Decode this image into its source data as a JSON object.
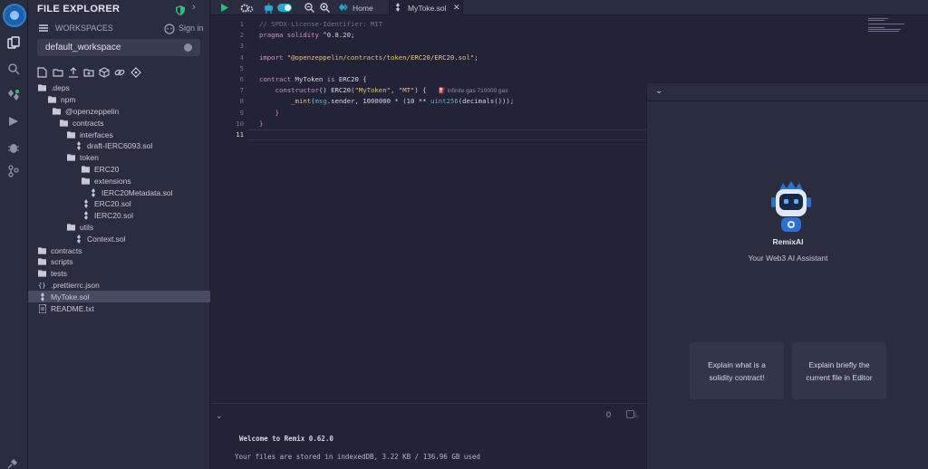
{
  "explorer": {
    "title": "FILE EXPLORER",
    "workspaces_label": "WORKSPACES",
    "signin_label": "Sign in",
    "workspace_value": "default_workspace",
    "tree": [
      {
        "label": ".deps",
        "type": "folder",
        "depth": 0
      },
      {
        "label": "npm",
        "type": "folder",
        "depth": 1
      },
      {
        "label": "@openzeppelin",
        "type": "folder",
        "depth": 2
      },
      {
        "label": "contracts",
        "type": "folder",
        "depth": 3
      },
      {
        "label": "interfaces",
        "type": "folder",
        "depth": 4
      },
      {
        "label": "draft-IERC6093.sol",
        "type": "sol",
        "depth": 5
      },
      {
        "label": "token",
        "type": "folder",
        "depth": 4
      },
      {
        "label": "ERC20",
        "type": "folder",
        "depth": 5
      },
      {
        "label": "extensions",
        "type": "folder",
        "depth": 6
      },
      {
        "label": "IERC20Metadata.sol",
        "type": "sol",
        "depth": 7
      },
      {
        "label": "ERC20.sol",
        "type": "sol",
        "depth": 6
      },
      {
        "label": "IERC20.sol",
        "type": "sol",
        "depth": 6
      },
      {
        "label": "utils",
        "type": "folder",
        "depth": 4
      },
      {
        "label": "Context.sol",
        "type": "sol",
        "depth": 5
      },
      {
        "label": "contracts",
        "type": "folder",
        "depth": 0
      },
      {
        "label": "scripts",
        "type": "folder",
        "depth": 0
      },
      {
        "label": "tests",
        "type": "folder",
        "depth": 0
      },
      {
        "label": ".prettierrc.json",
        "type": "json",
        "depth": 0
      },
      {
        "label": "MyToke.sol",
        "type": "sol",
        "depth": 0,
        "selected": true
      },
      {
        "label": "README.txt",
        "type": "txt",
        "depth": 0
      }
    ]
  },
  "tabs": {
    "home_label": "Home",
    "file_label": "MyToke.sol"
  },
  "editor": {
    "line_numbers": [
      "1",
      "2",
      "3",
      "4",
      "5",
      "6",
      "7",
      "8",
      "9",
      "10",
      "11"
    ],
    "current_line": "11",
    "gas_hint": "infinite gas 710000 gas",
    "code": {
      "l1": "// SPDX-License-Identifier: MIT",
      "l2_kw": "pragma solidity",
      "l2_val": " ^0.8.20;",
      "l4_kw": "import",
      "l4_str": "\"@openzeppelin/contracts/token/ERC20/ERC20.sol\"",
      "l4_end": ";",
      "l6_kw": "contract",
      "l6_name": " MyToken ",
      "l6_is": "is",
      "l6_rest": " ERC20 {",
      "l7_kw": "constructor",
      "l7_a": "() ERC20(",
      "l7_s1": "\"MyToken\"",
      "l7_b": ", ",
      "l7_s2": "\"MT\"",
      "l7_c": ") {",
      "l8_fn": "_mint",
      "l8_a": "(",
      "l8_msg": "msg",
      "l8_b": ".sender, 1000000 * (10 ** ",
      "l8_ty": "uint256",
      "l8_c": "(decimals()));",
      "l9": "}",
      "l10": "}"
    }
  },
  "terminal": {
    "count": "0",
    "clear_label": "L",
    "welcome": "Welcome to Remix 0.62.0",
    "storage": "Your files are stored in indexedDB, 3.22 KB / 136.96 GB used"
  },
  "ai": {
    "name": "RemixAI",
    "subtitle": "Your Web3 AI Assistant",
    "suggestion1": "Explain what is a solidity contract!",
    "suggestion2": "Explain briefly the current file in Editor"
  },
  "colors": {
    "accent": "#29a6c9",
    "run": "#2fbf71",
    "background": "#222336",
    "panel": "#2a2c3f"
  }
}
